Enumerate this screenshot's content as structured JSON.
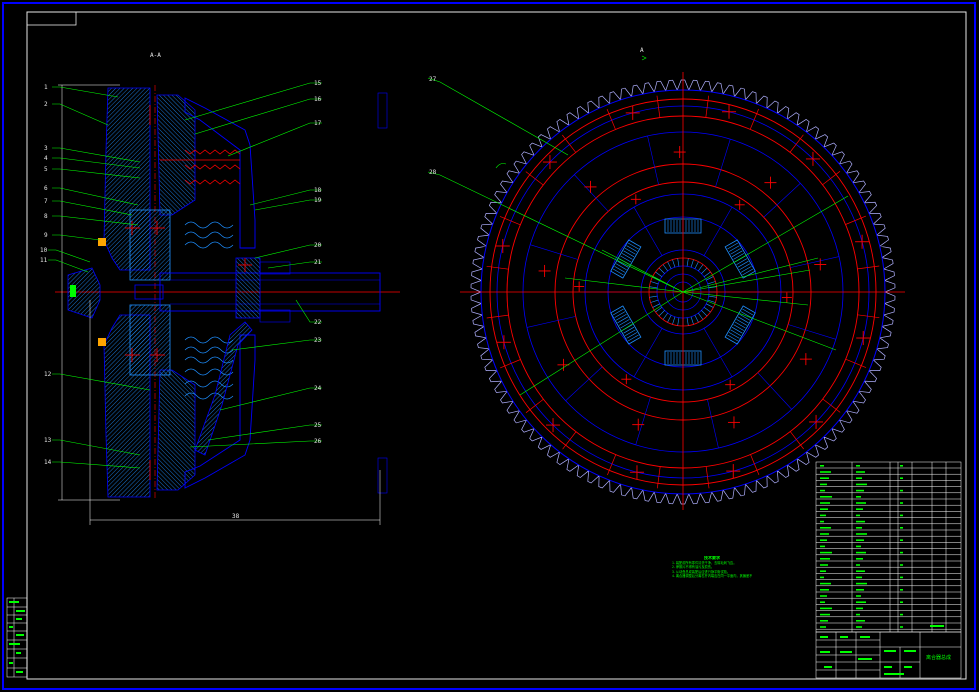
{
  "section_title": "A-A",
  "view_marker": "A",
  "overall_dim": "38",
  "left_callouts": [
    "1",
    "2",
    "3",
    "4",
    "5",
    "6",
    "7",
    "8",
    "9",
    "10",
    "11",
    "12",
    "13",
    "14"
  ],
  "right_callouts": [
    "15",
    "16",
    "17",
    "18",
    "19",
    "20",
    "21",
    "22",
    "23",
    "24",
    "25",
    "26"
  ],
  "front_callouts": [
    "27",
    "28"
  ],
  "notes": {
    "title": "技术要求",
    "lines": [
      "1.装配前所有零件清洗干净，去除毛刺飞边。",
      "2.摩擦片不得有油污及损伤。",
      "3.从动盘总成装配后应进行静平衡试验。",
      "4.离合器调整后分离杠杆内端应在同一平面内，其偏差不大于0.2mm。"
    ]
  },
  "title_block": {
    "drawing_name": "离合器总成"
  },
  "colors": {
    "outline": "#0000ff",
    "center_line": "#ff0000",
    "hatch": "#1e8fff",
    "leader": "#00ff00",
    "teeth": "#b0b0ff",
    "text": "#e6e6e6"
  }
}
